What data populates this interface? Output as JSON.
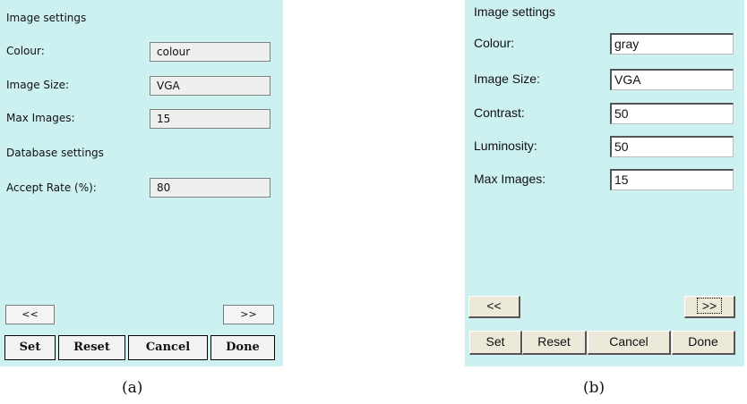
{
  "panel_a": {
    "section1_title": "Image settings",
    "fields": [
      {
        "label": "Colour:",
        "value": "colour"
      },
      {
        "label": "Image Size:",
        "value": "VGA"
      },
      {
        "label": "Max Images:",
        "value": "15"
      }
    ],
    "section2_title": "Database settings",
    "db_field": {
      "label": "Accept Rate (%):",
      "value": "80"
    },
    "prev_label": "<<",
    "next_label": ">>",
    "buttons": [
      "Set",
      "Reset",
      "Cancel",
      "Done"
    ],
    "caption": "(a)"
  },
  "panel_b": {
    "section_title": "Image settings",
    "fields": [
      {
        "label": "Colour:",
        "value": "gray"
      },
      {
        "label": "Image Size:",
        "value": "VGA"
      },
      {
        "label": "Contrast:",
        "value": "50"
      },
      {
        "label": "Luminosity:",
        "value": "50"
      },
      {
        "label": "Max Images:",
        "value": "15"
      }
    ],
    "prev_label": "<<",
    "next_label": ">>",
    "buttons": [
      "Set",
      "Reset",
      "Cancel",
      "Done"
    ],
    "caption": "(b)"
  }
}
